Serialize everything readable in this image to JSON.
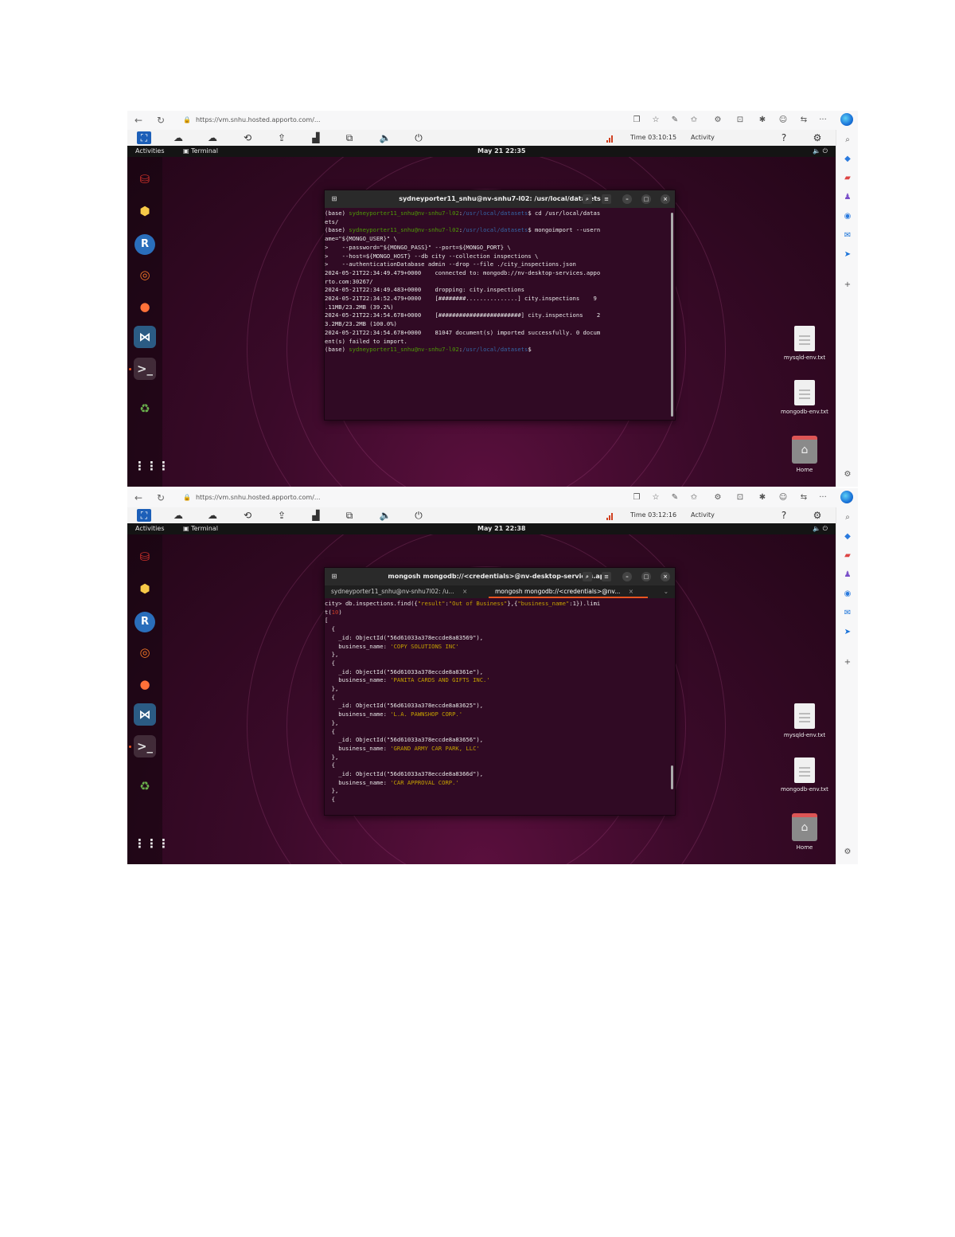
{
  "screenshots": [
    {
      "url": "https://vm.snhu.hosted.apporto.com/...",
      "vm_info": {
        "time": "Time 03:10:15",
        "activity": "Activity"
      },
      "topbar": {
        "activities": "Activities",
        "app": "Terminal",
        "clock": "May 21 22:35"
      },
      "terminal": {
        "title": "sydneyporter11_snhu@nv-snhu7-l02: /usr/local/datasets",
        "tabs": [],
        "lines": [
          [
            {
              "t": "(base) ",
              "c": ""
            },
            {
              "t": "sydneyporter11_snhu@nv-snhu7-l02",
              "c": "pr-user"
            },
            {
              "t": ":",
              "c": ""
            },
            {
              "t": "/usr/local/datasets",
              "c": "pr-path"
            },
            {
              "t": "$ cd /usr/local/datas",
              "c": ""
            }
          ],
          [
            {
              "t": "ets/",
              "c": ""
            }
          ],
          [
            {
              "t": "(base) ",
              "c": ""
            },
            {
              "t": "sydneyporter11_snhu@nv-snhu7-l02",
              "c": "pr-user"
            },
            {
              "t": ":",
              "c": ""
            },
            {
              "t": "/usr/local/datasets",
              "c": "pr-path"
            },
            {
              "t": "$ mongoimport --usern",
              "c": ""
            }
          ],
          [
            {
              "t": "ame=\"${MONGO_USER}\" \\",
              "c": ""
            }
          ],
          [
            {
              "t": ">    --password=\"${MONGO_PASS}\" --port=${MONGO_PORT} \\",
              "c": ""
            }
          ],
          [
            {
              "t": ">    --host=${MONGO_HOST} --db city --collection inspections \\",
              "c": ""
            }
          ],
          [
            {
              "t": ">    --authenticationDatabase admin --drop --file ./city_inspections.json",
              "c": ""
            }
          ],
          [
            {
              "t": "2024-05-21T22:34:49.479+0000    connected to: mongodb://nv-desktop-services.appo",
              "c": ""
            }
          ],
          [
            {
              "t": "rto.com:30267/",
              "c": ""
            }
          ],
          [
            {
              "t": "2024-05-21T22:34:49.483+0000    dropping: city.inspections",
              "c": ""
            }
          ],
          [
            {
              "t": "2024-05-21T22:34:52.479+0000    [########...............] city.inspections    9",
              "c": ""
            }
          ],
          [
            {
              "t": ".11MB/23.2MB (39.2%)",
              "c": ""
            }
          ],
          [
            {
              "t": "2024-05-21T22:34:54.678+0000    [########################] city.inspections    2",
              "c": ""
            }
          ],
          [
            {
              "t": "3.2MB/23.2MB (100.0%)",
              "c": ""
            }
          ],
          [
            {
              "t": "2024-05-21T22:34:54.678+0000    81047 document(s) imported successfully. 0 docum",
              "c": ""
            }
          ],
          [
            {
              "t": "ent(s) failed to import.",
              "c": ""
            }
          ],
          [
            {
              "t": "(base) ",
              "c": ""
            },
            {
              "t": "sydneyporter11_snhu@nv-snhu7-l02",
              "c": "pr-user"
            },
            {
              "t": ":",
              "c": ""
            },
            {
              "t": "/usr/local/datasets",
              "c": "pr-path"
            },
            {
              "t": "$",
              "c": ""
            }
          ]
        ]
      }
    },
    {
      "url": "https://vm.snhu.hosted.apporto.com/...",
      "vm_info": {
        "time": "Time 03:12:16",
        "activity": "Activity"
      },
      "topbar": {
        "activities": "Activities",
        "app": "Terminal",
        "clock": "May 21 22:38"
      },
      "terminal": {
        "title": "mongosh mongodb://<credentials>@nv-desktop-services.ap...",
        "tabs": [
          "sydneyporter11_snhu@nv-snhu7l02: /u...",
          "mongosh mongodb://<credentials>@nv..."
        ],
        "lines": [
          [
            {
              "t": "city> db.inspections.find({",
              "c": ""
            },
            {
              "t": "\"result\"",
              "c": "str"
            },
            {
              "t": ":",
              "c": ""
            },
            {
              "t": "\"Out of Business\"",
              "c": "str"
            },
            {
              "t": "},{",
              "c": ""
            },
            {
              "t": "\"business_name\"",
              "c": "str"
            },
            {
              "t": ":1}).limi",
              "c": ""
            }
          ],
          [
            {
              "t": "t(",
              "c": ""
            },
            {
              "t": "10",
              "c": "num"
            },
            {
              "t": ")",
              "c": ""
            }
          ],
          [
            {
              "t": "[",
              "c": ""
            }
          ],
          [
            {
              "t": "  {",
              "c": ""
            }
          ],
          [
            {
              "t": "    _id: ObjectId(\"56d61033a378eccde8a83569\"),",
              "c": ""
            }
          ],
          [
            {
              "t": "    business_name: ",
              "c": ""
            },
            {
              "t": "'COPY SOLUTIONS INC'",
              "c": "str"
            }
          ],
          [
            {
              "t": "  },",
              "c": ""
            }
          ],
          [
            {
              "t": "  {",
              "c": ""
            }
          ],
          [
            {
              "t": "    _id: ObjectId(\"56d61033a378eccde8a8361e\"),",
              "c": ""
            }
          ],
          [
            {
              "t": "    business_name: ",
              "c": ""
            },
            {
              "t": "'PANITA CARDS AND GIFTS INC.'",
              "c": "str"
            }
          ],
          [
            {
              "t": "  },",
              "c": ""
            }
          ],
          [
            {
              "t": "  {",
              "c": ""
            }
          ],
          [
            {
              "t": "    _id: ObjectId(\"56d61033a378eccde8a83625\"),",
              "c": ""
            }
          ],
          [
            {
              "t": "    business_name: ",
              "c": ""
            },
            {
              "t": "'L.A. PAWNSHOP CORP.'",
              "c": "str"
            }
          ],
          [
            {
              "t": "  },",
              "c": ""
            }
          ],
          [
            {
              "t": "  {",
              "c": ""
            }
          ],
          [
            {
              "t": "    _id: ObjectId(\"56d61033a378eccde8a83656\"),",
              "c": ""
            }
          ],
          [
            {
              "t": "    business_name: ",
              "c": ""
            },
            {
              "t": "'GRAND ARMY CAR PARK, LLC'",
              "c": "str"
            }
          ],
          [
            {
              "t": "  },",
              "c": ""
            }
          ],
          [
            {
              "t": "  {",
              "c": ""
            }
          ],
          [
            {
              "t": "    _id: ObjectId(\"56d61033a378eccde8a8366d\"),",
              "c": ""
            }
          ],
          [
            {
              "t": "    business_name: ",
              "c": ""
            },
            {
              "t": "'CAR APPROVAL CORP.'",
              "c": "str"
            }
          ],
          [
            {
              "t": "  },",
              "c": ""
            }
          ],
          [
            {
              "t": "  {",
              "c": ""
            }
          ]
        ]
      }
    }
  ],
  "desktop_files": [
    "mysqld-env.txt",
    "mongodb-env.txt",
    "Home"
  ],
  "dock": [
    "R"
  ],
  "colors": {
    "accent": "#e95420",
    "desktop": "#3a0a29",
    "terminal_bg": "#300a24",
    "prompt_user": "#4e9a06",
    "prompt_path": "#3465a4"
  }
}
